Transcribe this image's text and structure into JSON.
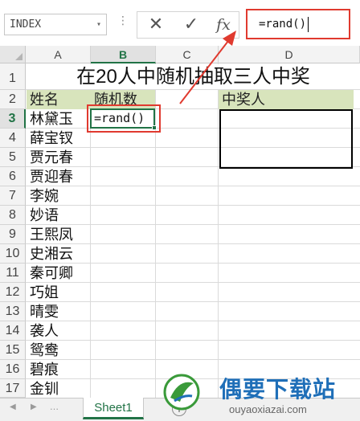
{
  "formula_bar": {
    "name_box": "INDEX",
    "cancel_glyph": "✕",
    "enter_glyph": "✓",
    "fx_label": "fx",
    "formula": "=rand()"
  },
  "columns": [
    "A",
    "B",
    "C",
    "D"
  ],
  "selected_column": "B",
  "rows": [
    "1",
    "2",
    "3",
    "4",
    "5",
    "6",
    "7",
    "8",
    "9",
    "10",
    "11",
    "12",
    "13",
    "14",
    "15",
    "16",
    "17"
  ],
  "selected_row": "3",
  "sheet": {
    "title": "在20人中随机抽取三人中奖",
    "col_a_header": "姓名",
    "col_b_header": "随机数",
    "col_d_header": "中奖人",
    "names": [
      "林黛玉",
      "薛宝钗",
      "贾元春",
      "贾迎春",
      "李婉",
      "妙语",
      "王熙凤",
      "史湘云",
      "秦可卿",
      "巧姐",
      "晴雯",
      "袭人",
      "鸳鸯",
      "碧痕",
      "金钏"
    ],
    "active_cell_value": "=rand()"
  },
  "tabs": {
    "sheets": [
      "Sheet1"
    ]
  },
  "watermark": {
    "title": "偶要下载站",
    "url": "ouyaoxiazai.com"
  },
  "colors": {
    "accent_green": "#217346",
    "highlight_red": "#e03a2f",
    "header_fill": "#d8e4bc",
    "watermark_blue": "#1f6fb8"
  }
}
